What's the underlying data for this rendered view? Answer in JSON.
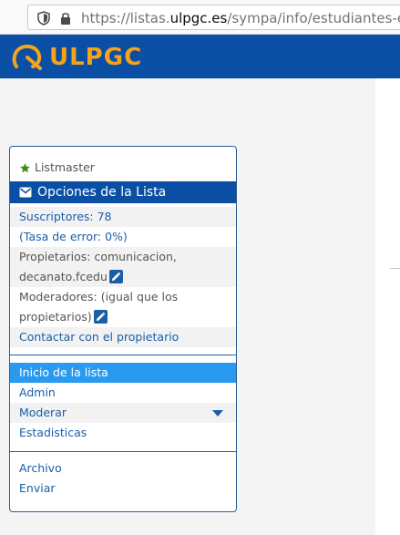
{
  "browser": {
    "url_prefix": "https://listas.",
    "url_domain": "ulpgc.es",
    "url_suffix": "/sympa/info/estudiantes-ed"
  },
  "header": {
    "logo_text": "ULPGC",
    "brand_color": "#0a4fa3",
    "logo_color": "#f5a31a"
  },
  "sidebar": {
    "role_label": "Listmaster",
    "section_title": "Opciones de la Lista",
    "info": {
      "subscribers": "Suscriptores: 78",
      "error_rate": "(Tasa de error: 0%)",
      "owners_line1": "Propietarios: comunicacion,",
      "owners_line2": "decanato.fcedu",
      "moderators_line1": "Moderadores: (igual que los",
      "moderators_line2": "propietarios)",
      "contact": "Contactar con el propietario"
    },
    "nav": {
      "home": "Inicio de la lista",
      "admin": "Admin",
      "moderate": "Moderar",
      "stats": "Estadisticas"
    },
    "actions": {
      "archive": "Archivo",
      "send": "Enviar"
    },
    "active_color": "#2a9af0"
  }
}
